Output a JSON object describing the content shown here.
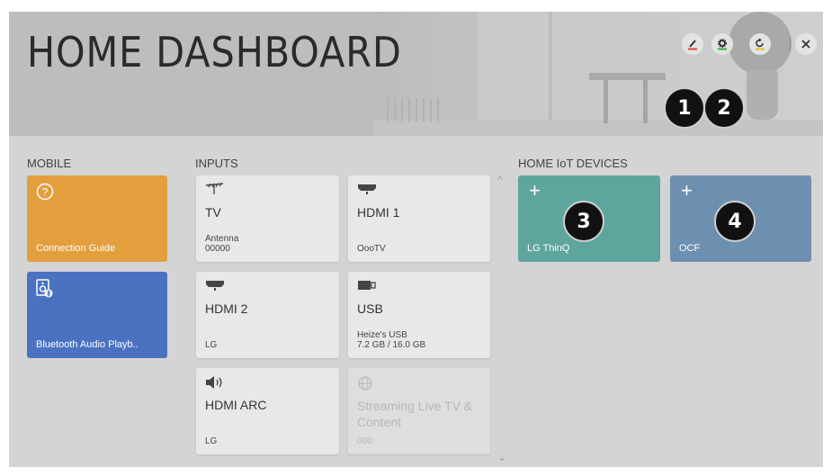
{
  "header": {
    "title": "HOME DASHBOARD",
    "buttons": {
      "edit": "edit-icon",
      "settings": "gear-icon",
      "refresh": "refresh-icon",
      "close": "close-icon"
    }
  },
  "markers": [
    "1",
    "2",
    "3",
    "4"
  ],
  "mobile": {
    "label": "MOBILE",
    "cards": [
      {
        "title": "Connection Guide",
        "icon": "question-icon",
        "color": "#e39e3e"
      },
      {
        "title": "Bluetooth Audio Playb..",
        "icon": "bluetooth-speaker-icon",
        "color": "#4a72c0"
      }
    ]
  },
  "inputs": {
    "label": "INPUTS",
    "cards": [
      {
        "name": "TV",
        "detail1": "Antenna",
        "detail2": "00000",
        "icon": "antenna-icon"
      },
      {
        "name": "HDMI 1",
        "detail1": "",
        "detail2": "OooTV",
        "icon": "hdmi-icon"
      },
      {
        "name": "HDMI 2",
        "detail1": "",
        "detail2": "LG",
        "icon": "hdmi-icon"
      },
      {
        "name": "USB",
        "detail1": "Heize's USB",
        "detail2": "7.2 GB / 16.0 GB",
        "icon": "usb-icon"
      },
      {
        "name": "HDMI ARC",
        "detail1": "",
        "detail2": "LG",
        "icon": "speaker-icon"
      },
      {
        "name": "Streaming Live TV & Content",
        "detail1": "",
        "detail2": "000",
        "icon": "globe-icon"
      }
    ]
  },
  "iot": {
    "label": "HOME IoT DEVICES",
    "cards": [
      {
        "title": "LG ThinQ",
        "color": "#5ea59e"
      },
      {
        "title": "OCF",
        "color": "#6d8fb0"
      }
    ],
    "plus": "+"
  },
  "scroll": {
    "up": "^",
    "down": "⌄"
  }
}
